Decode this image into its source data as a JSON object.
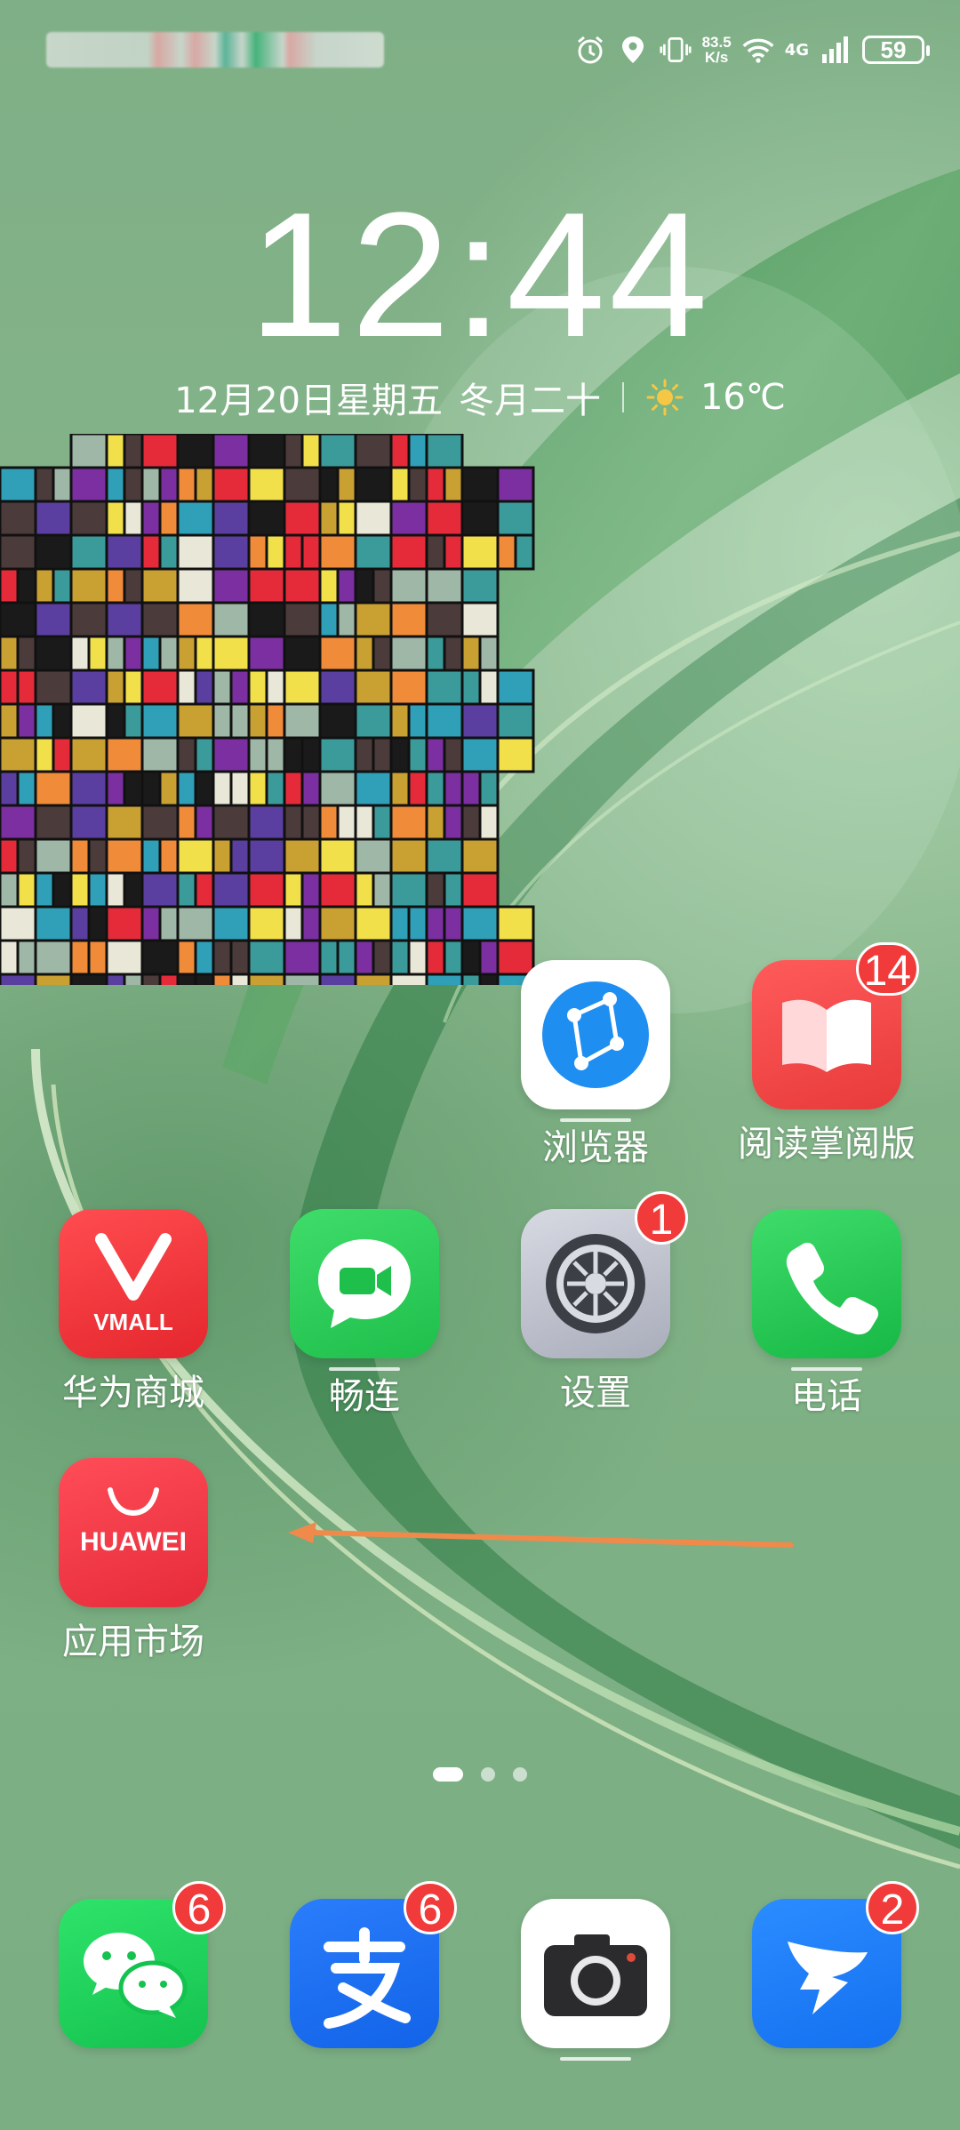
{
  "status_bar": {
    "net_speed_value": "83.5",
    "net_speed_unit": "K/s",
    "network_type": "4G",
    "battery": "59"
  },
  "lockscreen": {
    "time": "12:44",
    "date": "12月20日星期五",
    "lunar": "冬月二十",
    "temperature": "16℃"
  },
  "apps": {
    "browser": {
      "label": "浏览器"
    },
    "reader": {
      "label": "阅读掌阅版",
      "badge": "14"
    },
    "vmall": {
      "label": "华为商城",
      "icon_text": "VMALL"
    },
    "meetime": {
      "label": "畅连"
    },
    "settings": {
      "label": "设置",
      "badge": "1"
    },
    "phone": {
      "label": "电话"
    },
    "appgallery": {
      "label": "应用市场",
      "icon_text": "HUAWEI"
    }
  },
  "dock": {
    "wechat": {
      "badge": "6"
    },
    "alipay": {
      "badge": "6"
    },
    "camera": {},
    "dingtalk": {
      "badge": "2"
    }
  },
  "page_indicator": {
    "pages": 3,
    "current": 1
  },
  "colors": {
    "badge": "#f13a3a",
    "arrow": "#f08a4b"
  }
}
